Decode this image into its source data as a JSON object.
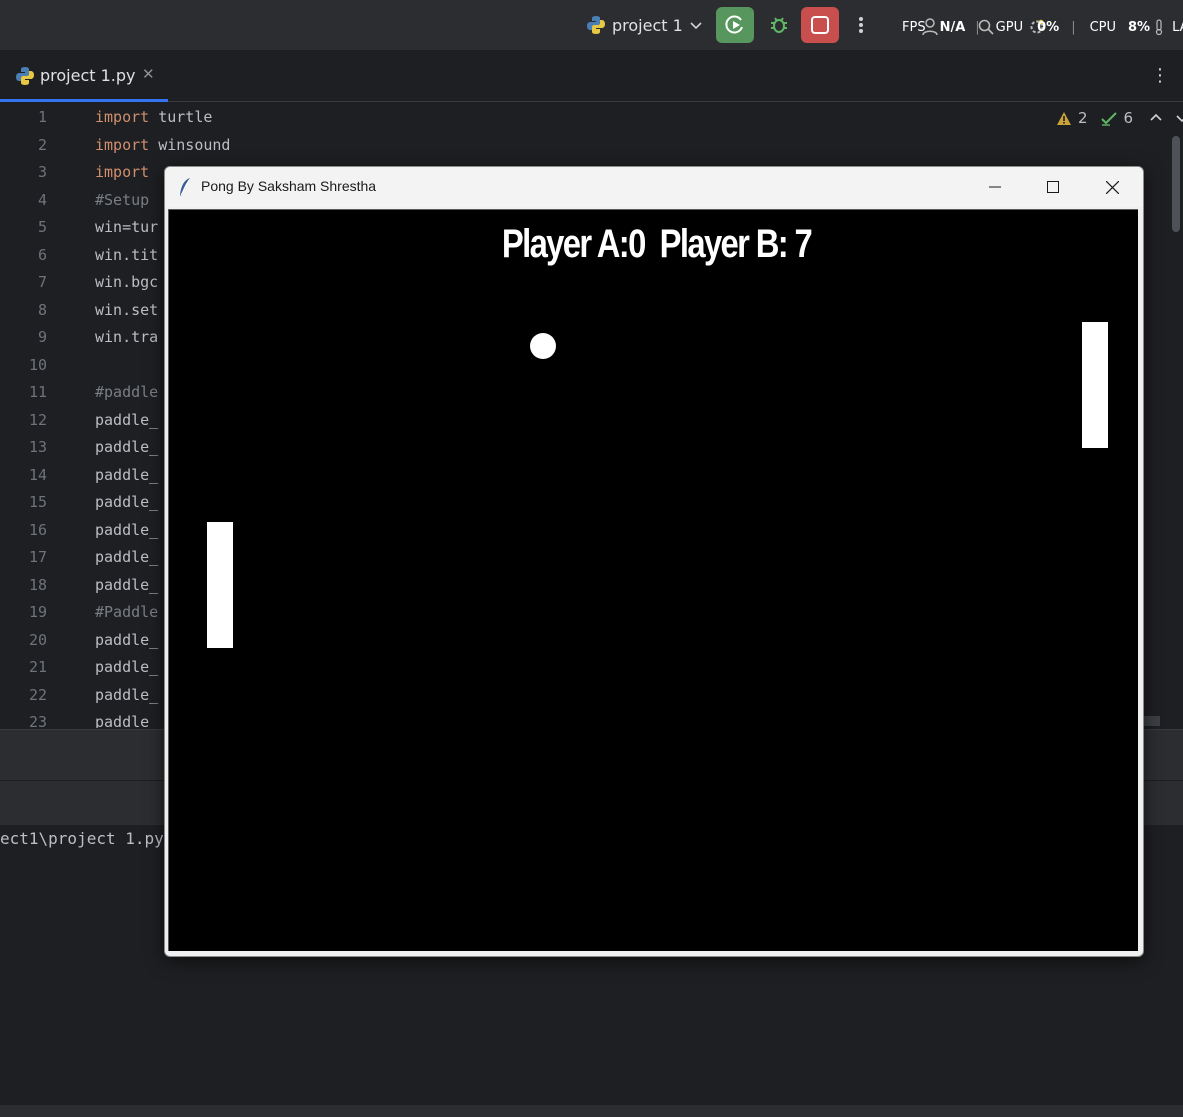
{
  "toolbar": {
    "project_name": "project 1",
    "overlay": {
      "fps_label": "FPS",
      "fps_value": "N/A",
      "gpu_label": "GPU",
      "gpu_value": "0%",
      "cpu_label": "CPU",
      "cpu_value": "8%",
      "lat_label": "LAT"
    }
  },
  "tabs": [
    {
      "label": "project 1.py"
    }
  ],
  "editor": {
    "inspection": {
      "warnings": "2",
      "ok": "6"
    },
    "lines": [
      {
        "n": "1",
        "kw": "import",
        "rest": " turtle"
      },
      {
        "n": "2",
        "kw": "import",
        "rest": " winsound"
      },
      {
        "n": "3",
        "kw": "import",
        "rest": ""
      },
      {
        "n": "4",
        "kw": "",
        "rest": "#Setup"
      },
      {
        "n": "5",
        "kw": "",
        "rest": "win=tur"
      },
      {
        "n": "6",
        "kw": "",
        "rest": "win.tit"
      },
      {
        "n": "7",
        "kw": "",
        "rest": "win.bgc"
      },
      {
        "n": "8",
        "kw": "",
        "rest": "win.set"
      },
      {
        "n": "9",
        "kw": "",
        "rest": "win.tra"
      },
      {
        "n": "10",
        "kw": "",
        "rest": ""
      },
      {
        "n": "11",
        "kw": "",
        "rest": "#paddle"
      },
      {
        "n": "12",
        "kw": "",
        "rest": "paddle_"
      },
      {
        "n": "13",
        "kw": "",
        "rest": "paddle_"
      },
      {
        "n": "14",
        "kw": "",
        "rest": "paddle_"
      },
      {
        "n": "15",
        "kw": "",
        "rest": "paddle_"
      },
      {
        "n": "16",
        "kw": "",
        "rest": "paddle_"
      },
      {
        "n": "17",
        "kw": "",
        "rest": "paddle_"
      },
      {
        "n": "18",
        "kw": "",
        "rest": "paddle_"
      },
      {
        "n": "19",
        "kw": "",
        "rest": "#Paddle"
      },
      {
        "n": "20",
        "kw": "",
        "rest": "paddle_"
      },
      {
        "n": "21",
        "kw": "",
        "rest": "paddle_"
      },
      {
        "n": "22",
        "kw": "",
        "rest": "paddle_"
      },
      {
        "n": "23",
        "kw": "",
        "rest": "paddle"
      }
    ]
  },
  "console": {
    "path": "ect1\\project 1.py"
  },
  "game_window": {
    "title": "Pong By Saksham Shrestha",
    "scoreboard": "Player A:0  Player B: 7"
  },
  "colors": {
    "run_button": "#57965c",
    "stop_button": "#c94f4f",
    "keyword": "#cf8e6d",
    "game_background": "#000000"
  }
}
